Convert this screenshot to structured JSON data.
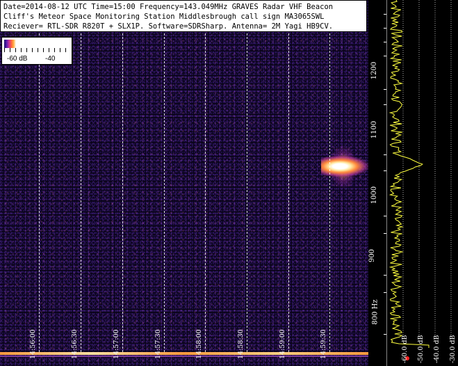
{
  "info": {
    "line1": "Date=2014-08-12 UTC Time=15:00 Frequency=143.049MHz GRAVES Radar VHF Beacon",
    "line2": "Cliff's Meteor Space Monitoring Station Middlesbrough call sign MA3065SWL",
    "line3": "Reciever= RTL-SDR R820T + SLX1P. Software=SDRSharp. Antenna= 2M Yagi HB9CV."
  },
  "legend": {
    "low": "-60 dB",
    "high": "-40"
  },
  "time_labels": [
    "14:56:00",
    "14:56:30",
    "14:57:00",
    "14:57:30",
    "14:58:00",
    "14:58:30",
    "14:59:00",
    "14:59:30"
  ],
  "freq_labels": [
    "1200",
    "1100",
    "1000",
    "900",
    "800 Hz"
  ],
  "db_labels": [
    "-60.0 dB",
    "-50.0 dB",
    "-40.0 dB",
    "-30.0 dB"
  ],
  "colors": {
    "background": "#000000",
    "trace": "#ffff40",
    "signal": "#ffe9a0"
  }
}
